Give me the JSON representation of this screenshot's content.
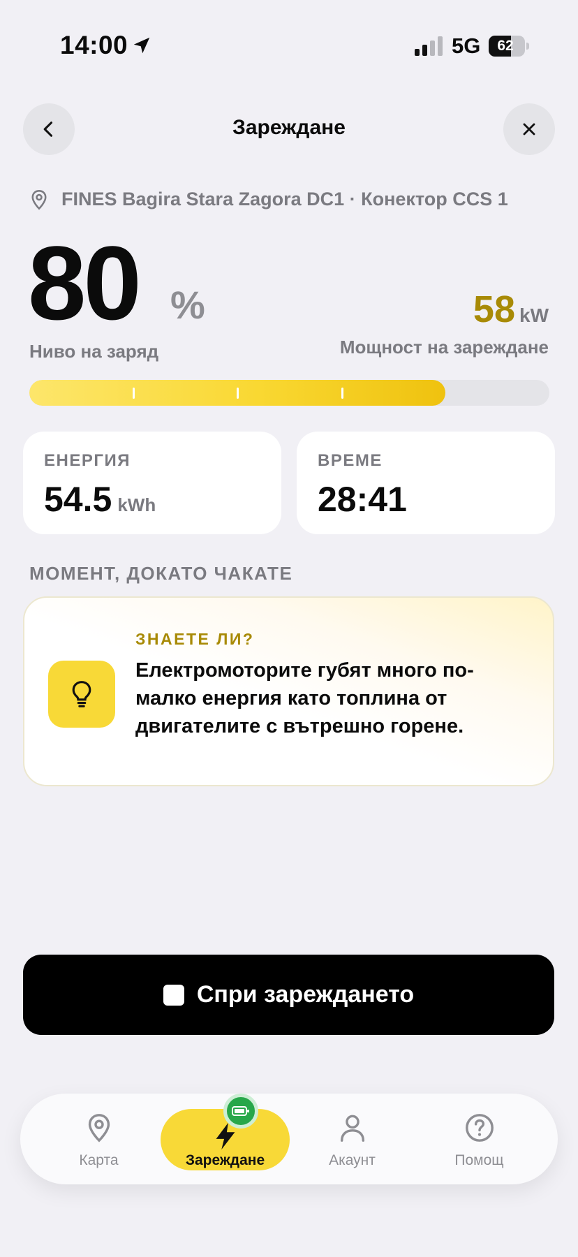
{
  "status_bar": {
    "time": "14:00",
    "network": "5G",
    "battery": "62",
    "battery_level": 0.62
  },
  "header": {
    "title": "Зареждане"
  },
  "location": {
    "text": "FINES Bagira Stara Zagora DC1 · Конектор CCS 1"
  },
  "charge": {
    "value": "80",
    "unit": "%",
    "label": "Ниво на заряд",
    "progress": 0.8
  },
  "power": {
    "value": "58",
    "unit": "kW",
    "label": "Мощност на зареждане"
  },
  "stats": {
    "energy": {
      "label": "ЕНЕРГИЯ",
      "value": "54.5",
      "unit": "kWh"
    },
    "time": {
      "label": "ВРЕМЕ",
      "value": "28:41"
    }
  },
  "section_title": "МОМЕНТ, ДОКАТО ЧАКАТЕ",
  "tip": {
    "kicker": "ЗНАЕТЕ ЛИ?",
    "text": "Електромоторите губят много по-малко енергия като топлина от двигателите с вътрешно горене."
  },
  "stop_button": {
    "label": "Спри зареждането"
  },
  "tabs": [
    {
      "label": "Карта",
      "icon": "map-pin-icon"
    },
    {
      "label": "Зареждане",
      "icon": "bolt-icon"
    },
    {
      "label": "Акаунт",
      "icon": "person-icon"
    },
    {
      "label": "Помощ",
      "icon": "help-icon"
    }
  ],
  "colors": {
    "accent": "#f8d937",
    "power_value": "#a88a06",
    "badge": "#27a74a",
    "background": "#f1f0f5"
  }
}
